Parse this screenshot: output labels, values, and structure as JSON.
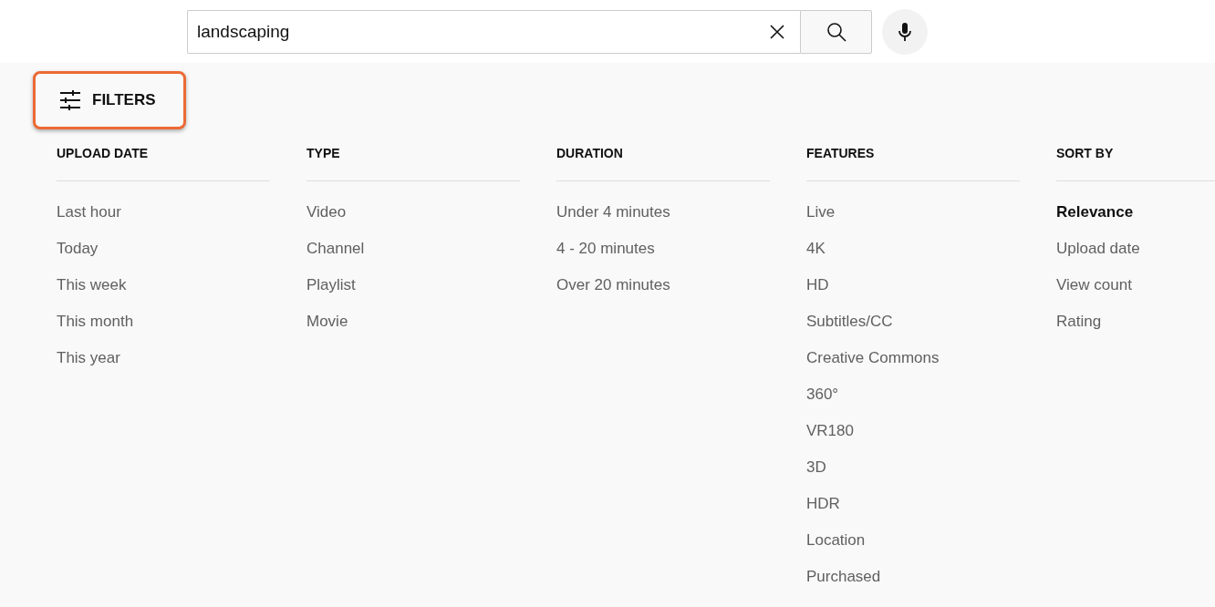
{
  "search": {
    "value": "landscaping"
  },
  "filters_button": {
    "label": "FILTERS"
  },
  "filter_groups": [
    {
      "title": "UPLOAD DATE",
      "options": [
        {
          "label": "Last hour",
          "selected": false
        },
        {
          "label": "Today",
          "selected": false
        },
        {
          "label": "This week",
          "selected": false
        },
        {
          "label": "This month",
          "selected": false
        },
        {
          "label": "This year",
          "selected": false
        }
      ]
    },
    {
      "title": "TYPE",
      "options": [
        {
          "label": "Video",
          "selected": false
        },
        {
          "label": "Channel",
          "selected": false
        },
        {
          "label": "Playlist",
          "selected": false
        },
        {
          "label": "Movie",
          "selected": false
        }
      ]
    },
    {
      "title": "DURATION",
      "options": [
        {
          "label": "Under 4 minutes",
          "selected": false
        },
        {
          "label": "4 - 20 minutes",
          "selected": false
        },
        {
          "label": "Over 20 minutes",
          "selected": false
        }
      ]
    },
    {
      "title": "FEATURES",
      "options": [
        {
          "label": "Live",
          "selected": false
        },
        {
          "label": "4K",
          "selected": false
        },
        {
          "label": "HD",
          "selected": false
        },
        {
          "label": "Subtitles/CC",
          "selected": false
        },
        {
          "label": "Creative Commons",
          "selected": false
        },
        {
          "label": "360°",
          "selected": false
        },
        {
          "label": "VR180",
          "selected": false
        },
        {
          "label": "3D",
          "selected": false
        },
        {
          "label": "HDR",
          "selected": false
        },
        {
          "label": "Location",
          "selected": false
        },
        {
          "label": "Purchased",
          "selected": false
        }
      ]
    },
    {
      "title": "SORT BY",
      "options": [
        {
          "label": "Relevance",
          "selected": true
        },
        {
          "label": "Upload date",
          "selected": false
        },
        {
          "label": "View count",
          "selected": false
        },
        {
          "label": "Rating",
          "selected": false
        }
      ]
    }
  ]
}
